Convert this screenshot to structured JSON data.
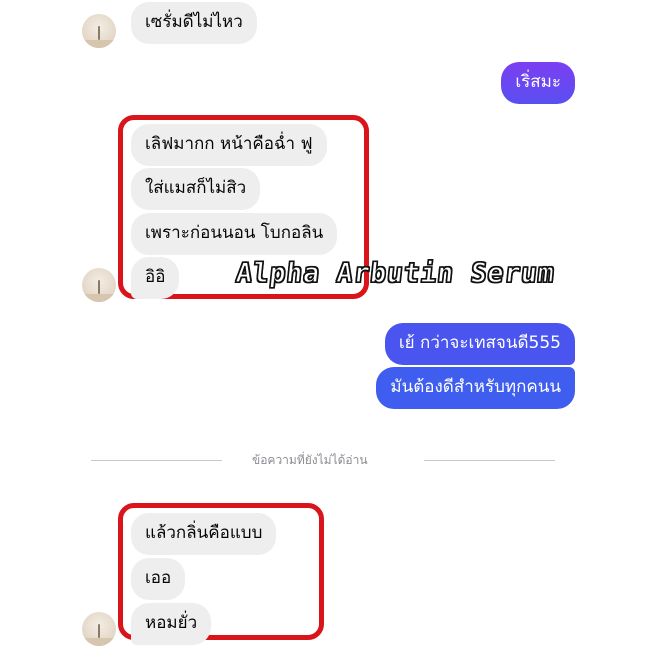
{
  "conversation": {
    "top_received": "เซรั่มดีไม่ไหว",
    "sent_question": "เริ่สมะ",
    "received_group_1": [
      "เลิฟมากก หน้าคือฉ่ำ ฟู",
      "ใส่แมสก็ไม่สิว",
      "เพราะก่อนนอน โบกอลิน",
      "อิอิ"
    ],
    "sent_group": [
      "เย้ กว่าจะเทสจนดี555",
      "มันต้องดีสำหรับทุกคนน"
    ],
    "unread_divider": "ข้อความที่ยังไม่ได้อ่าน",
    "received_group_2": [
      "แล้วกลิ่นคือแบบ",
      "เออ",
      "หอมยั่ว"
    ]
  },
  "overlay_caption": "Alpha Arbutin Serum",
  "colors": {
    "incoming_bubble": "#eeeeef",
    "outgoing_bubble_gradient_top": "#7b3ff2",
    "outgoing_bubble": "#3f5ef0",
    "highlight_frame": "#d9141b"
  }
}
